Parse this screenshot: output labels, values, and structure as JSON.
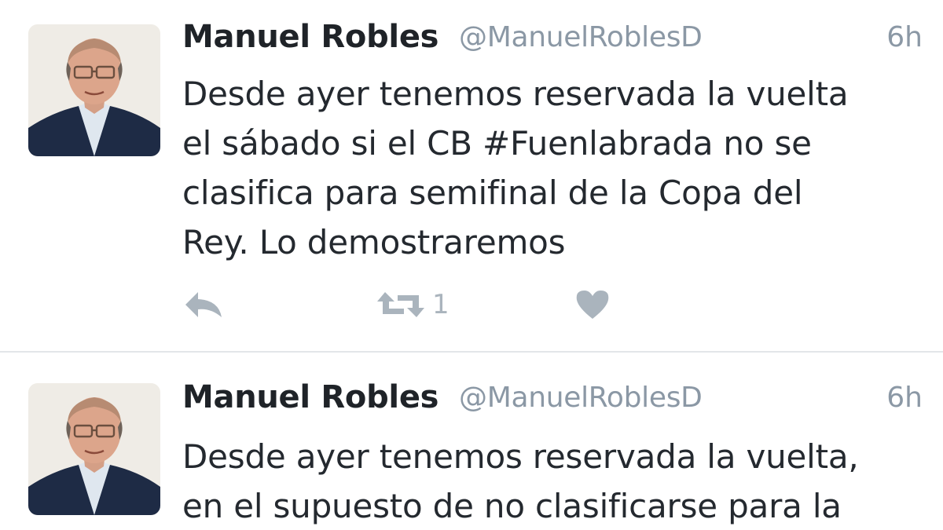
{
  "tweets": [
    {
      "author_name": "Manuel Robles",
      "author_handle": "@ManuelRoblesD",
      "time": "6h",
      "text_lines": [
        "Desde ayer tenemos reservada la vuelta",
        "el sábado si el CB #Fuenlabrada no se",
        "clasifica para semifinal de la Copa del",
        "Rey. Lo demostraremos"
      ],
      "actions": {
        "reply_icon": "reply-icon",
        "retweet_icon": "retweet-icon",
        "retweet_count": "1",
        "like_icon": "heart-icon"
      }
    },
    {
      "author_name": "Manuel Robles",
      "author_handle": "@ManuelRoblesD",
      "time": "6h",
      "text_lines": [
        "Desde ayer tenemos reservada la vuelta,",
        "en el supuesto de no clasificarse para la"
      ]
    }
  ],
  "colors": {
    "text": "#24292f",
    "muted": "#8b98a5",
    "icon": "#aab4bd",
    "divider": "#e3e6e9",
    "background": "#ffffff"
  }
}
